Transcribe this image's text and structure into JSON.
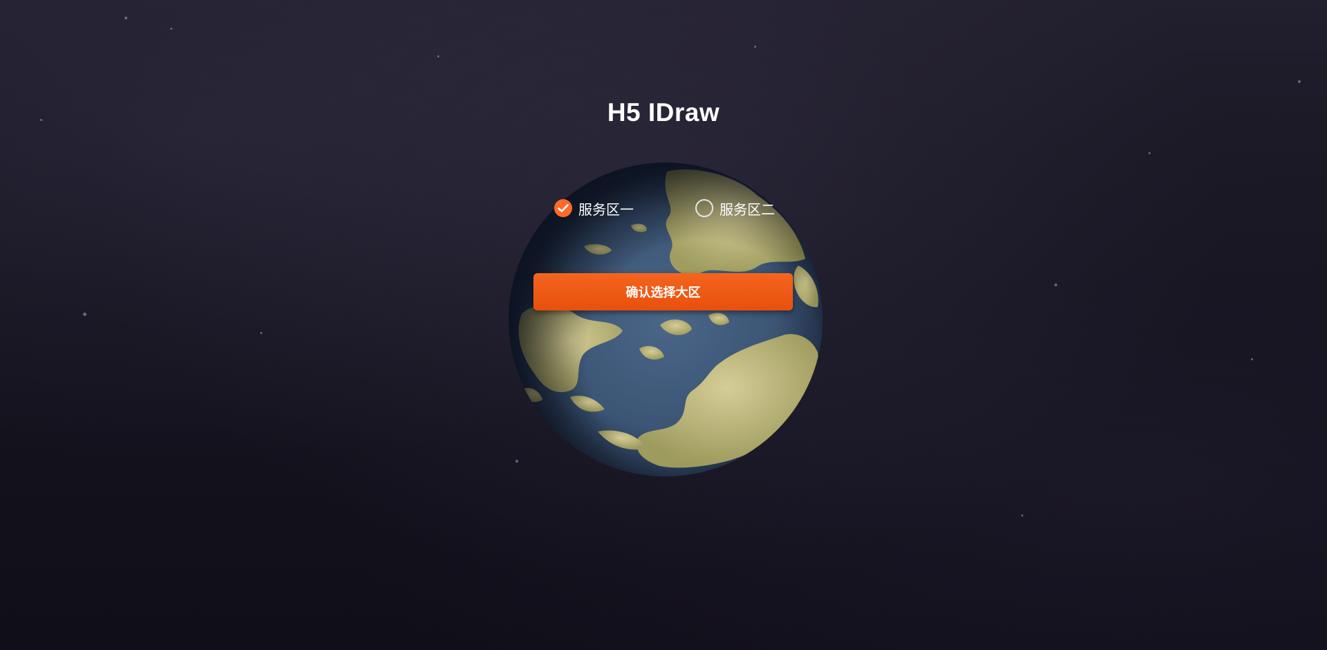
{
  "page": {
    "title": "H5 IDraw"
  },
  "region_options": [
    {
      "label": "服务区一",
      "selected": true
    },
    {
      "label": "服务区二",
      "selected": false
    }
  ],
  "confirm_button": {
    "label": "确认选择大区"
  },
  "colors": {
    "accent": "#ff6a2a",
    "button_top": "#f4651f",
    "button_bottom": "#e8500c",
    "background": "#15131f",
    "text": "#ffffff"
  },
  "icons": {
    "selected_radio": "check-circle-icon",
    "unselected_radio": "empty-circle-icon",
    "globe": "planet-globe"
  }
}
